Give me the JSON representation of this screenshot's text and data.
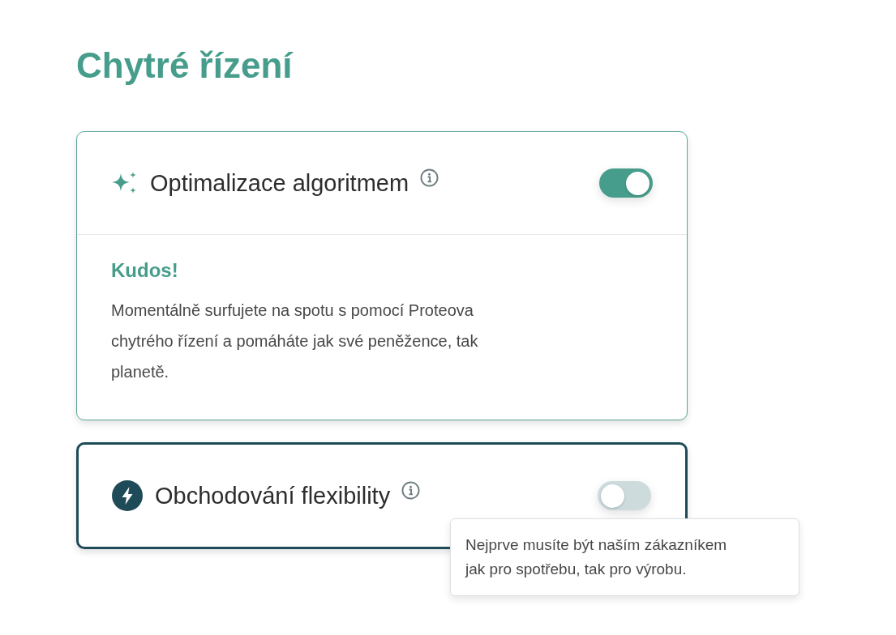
{
  "title": "Chytré řízení",
  "cards": [
    {
      "kind": "optimization",
      "title": "Optimalizace algoritmem",
      "on": true,
      "focused": false,
      "message": {
        "heading": "Kudos!",
        "text": "Momentálně surfujete na spotu s pomocí Proteova chytrého řízení a pomáháte jak své peněžence, tak planetě."
      }
    },
    {
      "kind": "trading",
      "title": "Obchodování flexibility",
      "on": false,
      "focused": true,
      "tooltip": {
        "text": "Nejprve musíte být naším zákazníkem jak pro spotřebu, tak pro výrobu."
      }
    }
  ]
}
